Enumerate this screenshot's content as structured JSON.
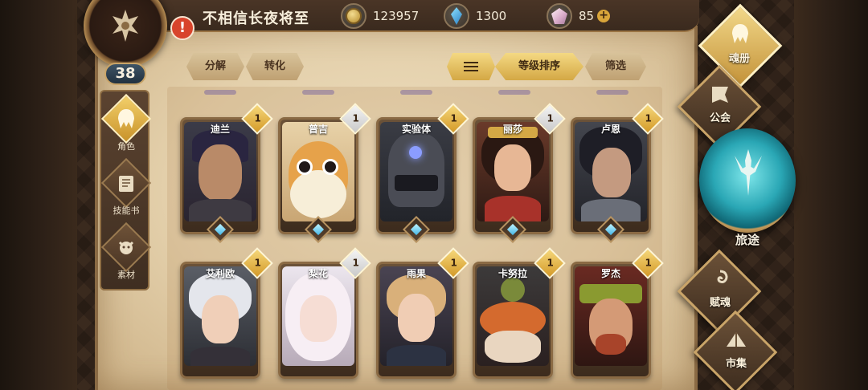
{
  "header": {
    "player_name": "不相信长夜将至",
    "level": "38",
    "currencies": [
      {
        "icon": "gold-coin-icon",
        "value": "123957"
      },
      {
        "icon": "blue-gem-icon",
        "value": "1300"
      },
      {
        "icon": "crystal-icon",
        "value": "85"
      }
    ],
    "add_label": "+",
    "alert_label": "!"
  },
  "left_tabs": [
    {
      "label": "角色",
      "icon": "helmet-icon",
      "active": true
    },
    {
      "label": "技能书",
      "icon": "book-icon",
      "active": false
    },
    {
      "label": "素材",
      "icon": "beast-icon",
      "active": false
    }
  ],
  "toolbar": {
    "decompose": "分解",
    "convert": "转化",
    "sort_by_level": "等级排序",
    "filter": "筛选"
  },
  "characters": [
    {
      "name": "迪兰",
      "count": "1",
      "rarity": "gold"
    },
    {
      "name": "普吉",
      "count": "1",
      "rarity": "silver"
    },
    {
      "name": "实验体",
      "count": "1",
      "rarity": "gold"
    },
    {
      "name": "丽莎",
      "count": "1",
      "rarity": "silver"
    },
    {
      "name": "卢恩",
      "count": "1",
      "rarity": "gold"
    },
    {
      "name": "艾利欧",
      "count": "1",
      "rarity": "gold"
    },
    {
      "name": "梨花",
      "count": "1",
      "rarity": "silver"
    },
    {
      "name": "雨果",
      "count": "1",
      "rarity": "gold"
    },
    {
      "name": "卡努拉",
      "count": "1",
      "rarity": "gold"
    },
    {
      "name": "罗杰",
      "count": "1",
      "rarity": "gold"
    }
  ],
  "right_menu": {
    "soul_book": "魂册",
    "guild": "公会",
    "journey": "旅途",
    "endow": "赋魂",
    "market": "市集"
  },
  "colors": {
    "accent_gold": "#d4a845",
    "parchment": "#e3cfaa",
    "frame_brown": "#8a6a44"
  }
}
